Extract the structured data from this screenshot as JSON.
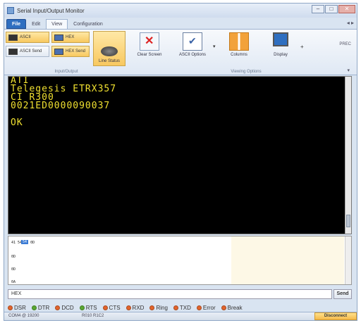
{
  "window": {
    "title": "Serial Input/Output Monitor",
    "controls": {
      "minimize": "–",
      "maximize": "□",
      "close": "✕"
    }
  },
  "menu": {
    "tabs": [
      {
        "label": "File"
      },
      {
        "label": "Edit"
      },
      {
        "label": "View"
      },
      {
        "label": "Configuration"
      }
    ],
    "quick_access": "◂ ▸"
  },
  "ribbon": {
    "io_group": {
      "label": "Input/Output",
      "ascii": "ASCII",
      "hex": "HEX",
      "ascii_send": "ASCII Send",
      "hex_send": "HEX Send",
      "line_status": "Line Status"
    },
    "clear_screen": "Clear Screen",
    "ascii_options": "ASCII Options",
    "columns": "Columns",
    "display": "Display",
    "viewing_group": {
      "label": "Viewing Options"
    },
    "right_label": "PREC"
  },
  "terminal": {
    "lines": [
      "ATI",
      "Telegesis ETRX357",
      "CI R300",
      "0021ED000009003​7",
      "",
      "OK"
    ]
  },
  "hex_panel": {
    "row1": "41 54 49 0D",
    "row1_selected": "54",
    "row2": "0D",
    "row3": "0D",
    "row4": "0A"
  },
  "send_bar": {
    "value": "HEX",
    "send_label": "Send"
  },
  "signals": [
    {
      "label": "DSR",
      "color": "#e2642c"
    },
    {
      "label": "DTR",
      "color": "#5aa832"
    },
    {
      "label": "DCD",
      "color": "#e2642c"
    },
    {
      "label": "RTS",
      "color": "#5aa832"
    },
    {
      "label": "CTS",
      "color": "#e2642c"
    },
    {
      "label": "RXD",
      "color": "#e2642c"
    },
    {
      "label": "Ring",
      "color": "#e2642c"
    },
    {
      "label": "TXD",
      "color": "#e2642c"
    },
    {
      "label": "Error",
      "color": "#e2642c"
    },
    {
      "label": "Break",
      "color": "#e2642c"
    }
  ],
  "status_bar": {
    "port": "COM4 @ 19200",
    "counters": "R010 R1C2",
    "disconnect_label": "Disconnect"
  }
}
